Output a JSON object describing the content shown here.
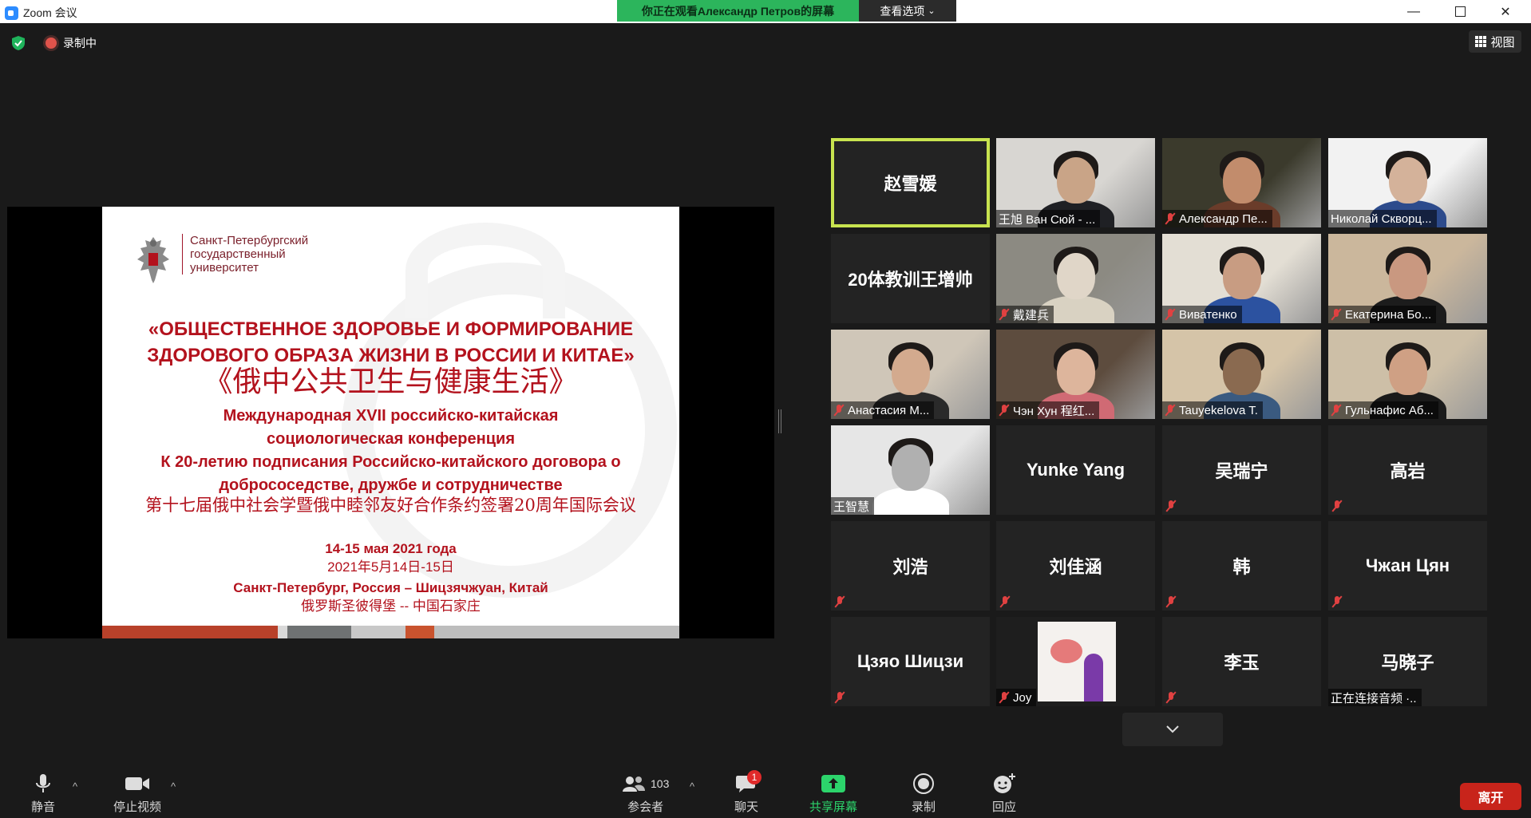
{
  "window": {
    "title": "Zoom 会议"
  },
  "share_banner": {
    "viewing": "你正在观看Александр  Петров的屏幕",
    "options": "查看选项"
  },
  "top": {
    "recording": "录制中",
    "view": "视图"
  },
  "slide": {
    "university": [
      "Санкт-Петербургский",
      "государственный",
      "университет"
    ],
    "title_ru_1": "«ОБЩЕСТВЕННОЕ ЗДОРОВЬЕ И ФОРМИРОВАНИЕ",
    "title_ru_2": "ЗДОРОВОГО ОБРАЗА ЖИЗНИ В РОССИИ И КИТАЕ»",
    "title_cn": "《俄中公共卫生与健康生活》",
    "conf_1": "Международная XVII российско-китайская",
    "conf_2": "социологическая конференция",
    "conf_3": "К 20-летию подписания Российско-китайского договора о",
    "conf_4": "добрососедстве, дружбе и сотрудничестве",
    "conf_cn": "第十七届俄中社会学暨俄中睦邻友好合作条约签署20周年国际会议",
    "date_ru": "14-15 мая 2021 года",
    "date_cn": "2021年5月14日-15日",
    "place_ru": "Санкт-Петербург, Россия – Шицзячжуан, Китай",
    "place_cn": "俄罗斯圣彼得堡 -- 中国石家庄",
    "bar_colors": [
      "#b8412a",
      "#b8412a",
      "#b8412a",
      "#b8412a",
      "#d9d9d9",
      "#6f7273",
      "#c8c8c8",
      "#c9532e",
      "#bdbdbd"
    ]
  },
  "participants": [
    {
      "name": "赵雪媛",
      "video": false,
      "muted": false,
      "active": true
    },
    {
      "name": "王旭 Ван Сюй - ...",
      "video": true,
      "muted": false
    },
    {
      "name": "Александр Пе...",
      "video": true,
      "muted": true
    },
    {
      "name": "Николай Скворц...",
      "video": true,
      "muted": false
    },
    {
      "name": "20体教训王增帅",
      "video": false,
      "muted": false
    },
    {
      "name": "戴建兵",
      "video": true,
      "muted": true
    },
    {
      "name": "Виватенко",
      "video": true,
      "muted": true
    },
    {
      "name": "Екатерина Бо...",
      "video": true,
      "muted": true
    },
    {
      "name": "Анастасия М...",
      "video": true,
      "muted": true
    },
    {
      "name": "Чэн Хун  程红...",
      "video": true,
      "muted": true
    },
    {
      "name": "Tauyekelova T.",
      "video": true,
      "muted": true
    },
    {
      "name": "Гульнафис Аб...",
      "video": true,
      "muted": true
    },
    {
      "name": "王智慧",
      "video": true,
      "muted": false
    },
    {
      "name": "Yunke Yang",
      "video": false,
      "muted": false
    },
    {
      "name": "吴瑞宁",
      "video": false,
      "muted": true
    },
    {
      "name": "高岩",
      "video": false,
      "muted": true
    },
    {
      "name": "刘浩",
      "video": false,
      "muted": true
    },
    {
      "name": "刘佳涵",
      "video": false,
      "muted": true
    },
    {
      "name": "韩",
      "video": false,
      "muted": true
    },
    {
      "name": "Чжан Цян",
      "video": false,
      "muted": true
    },
    {
      "name": "Цзяо Шицзи",
      "video": false,
      "muted": true
    },
    {
      "name": "Joy",
      "video": true,
      "muted": true
    },
    {
      "name": "李玉",
      "video": false,
      "muted": true
    },
    {
      "name": "马晓子",
      "video": false,
      "muted": false,
      "status": "正在连接音频 ·.."
    }
  ],
  "toolbar": {
    "mute": "静音",
    "stop_video": "停止视频",
    "participants": "参会者",
    "participants_count": "103",
    "chat": "聊天",
    "chat_badge": "1",
    "share": "共享屏幕",
    "record": "录制",
    "reactions": "回应",
    "leave": "离开"
  },
  "colors": {
    "accent_green": "#2cb55c",
    "active_border": "#c8e34f",
    "leave_red": "#c8241b",
    "slide_red": "#b3121d"
  }
}
